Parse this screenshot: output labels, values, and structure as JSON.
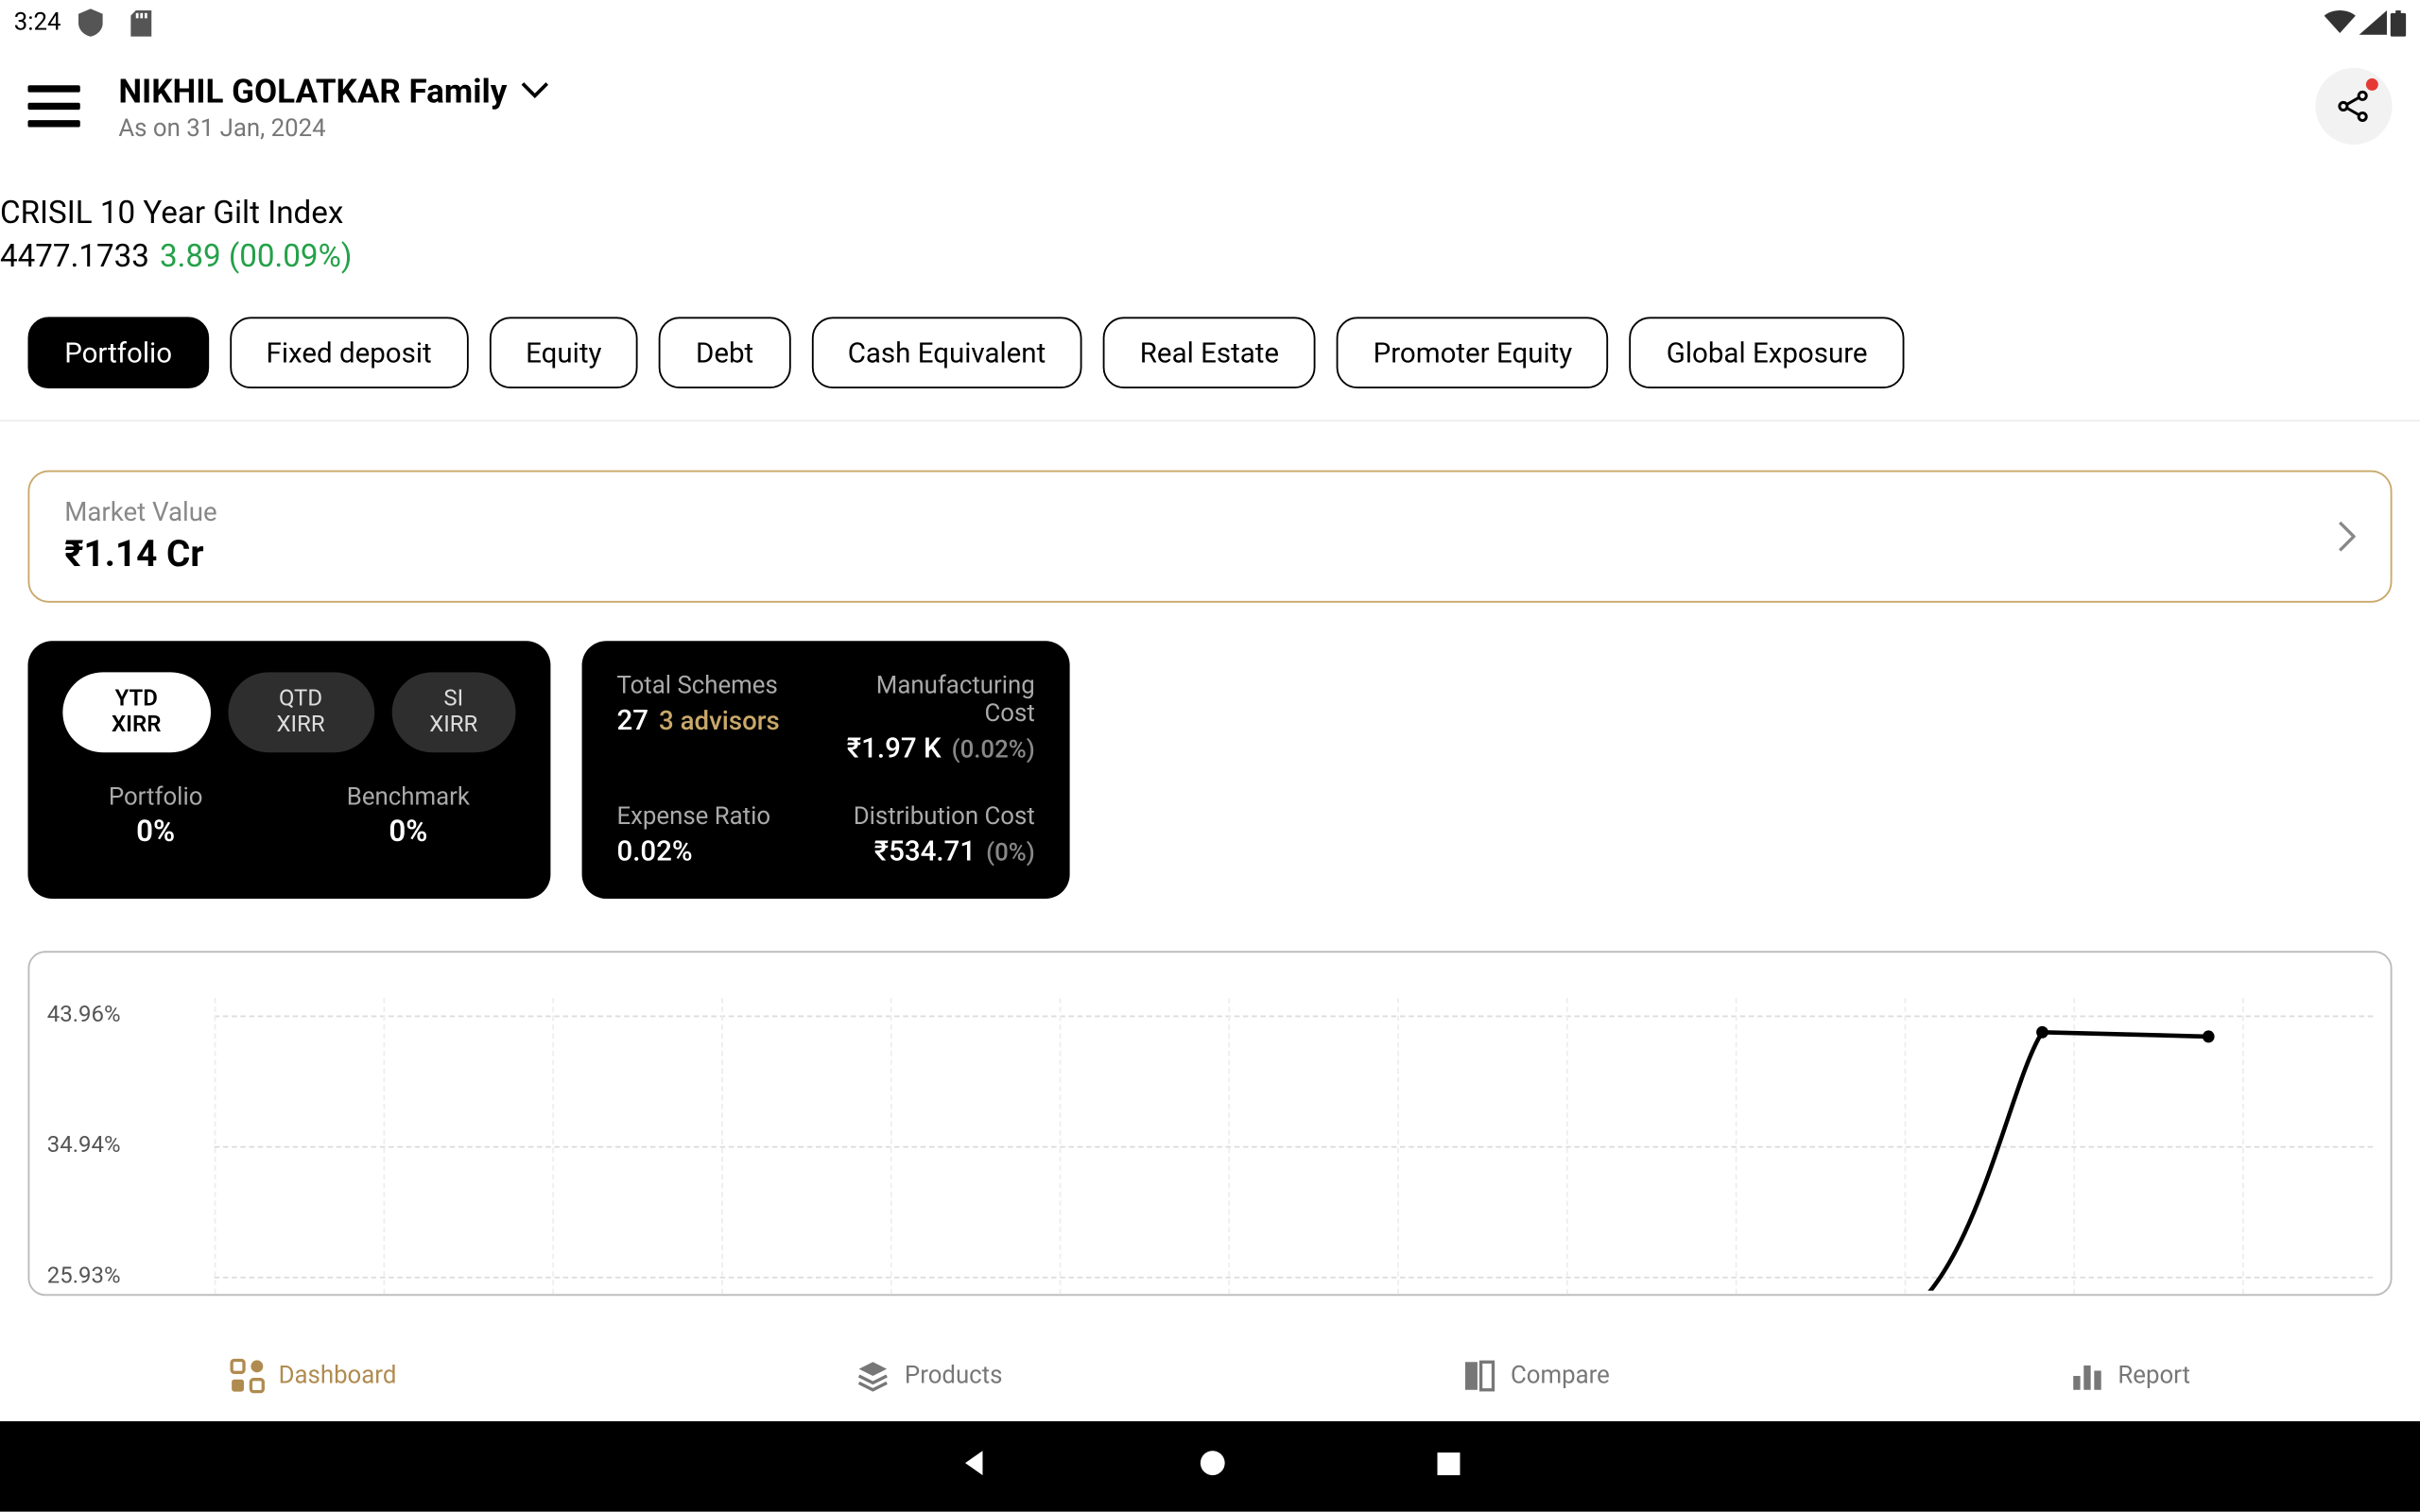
{
  "status_bar": {
    "time": "3:24"
  },
  "header": {
    "title": "NIKHIL GOLATKAR Family",
    "subtitle": "As on 31 Jan, 2024"
  },
  "ticker": {
    "name": "CRISIL 10 Year Gilt Index",
    "value": "4477.1733",
    "change": "3.89 (00.09%)"
  },
  "tabs": {
    "items": [
      {
        "label": "Portfolio",
        "active": true
      },
      {
        "label": "Fixed deposit",
        "active": false
      },
      {
        "label": "Equity",
        "active": false
      },
      {
        "label": "Debt",
        "active": false
      },
      {
        "label": "Cash Equivalent",
        "active": false
      },
      {
        "label": "Real Estate",
        "active": false
      },
      {
        "label": "Promoter Equity",
        "active": false
      },
      {
        "label": "Global Exposure",
        "active": false
      }
    ]
  },
  "market_value": {
    "label": "Market Value",
    "value": "₹1.14 Cr"
  },
  "xirr": {
    "pills": [
      {
        "label": "YTD XIRR",
        "active": true
      },
      {
        "label": "QTD XIRR",
        "active": false
      },
      {
        "label": "SI XIRR",
        "active": false
      }
    ],
    "portfolio_label": "Portfolio",
    "portfolio_value": "0%",
    "benchmark_label": "Benchmark",
    "benchmark_value": "0%"
  },
  "stats": {
    "total_schemes_label": "Total Schemes",
    "total_schemes_value": "27",
    "advisors": "3 advisors",
    "manufacturing_cost_label": "Manufacturing Cost",
    "manufacturing_cost_value": "₹1.97 K",
    "manufacturing_cost_pct": "(0.02%)",
    "expense_ratio_label": "Expense Ratio",
    "expense_ratio_value": "0.02%",
    "distribution_cost_label": "Distribution Cost",
    "distribution_cost_value": "₹534.71",
    "distribution_cost_pct": "(0%)"
  },
  "chart_data": {
    "type": "line",
    "ylabel": "",
    "xlabel": "",
    "ylim": [
      25.93,
      43.96
    ],
    "y_ticks": [
      "43.96%",
      "34.94%",
      "25.93%"
    ],
    "x_grid_count": 13,
    "series": [
      {
        "name": "Portfolio",
        "x": [
          11.0,
          12.0
        ],
        "values": [
          42.8,
          42.5
        ]
      }
    ]
  },
  "bottom_nav": {
    "items": [
      {
        "label": "Dashboard",
        "active": true
      },
      {
        "label": "Products",
        "active": false
      },
      {
        "label": "Compare",
        "active": false
      },
      {
        "label": "Report",
        "active": false
      }
    ]
  }
}
